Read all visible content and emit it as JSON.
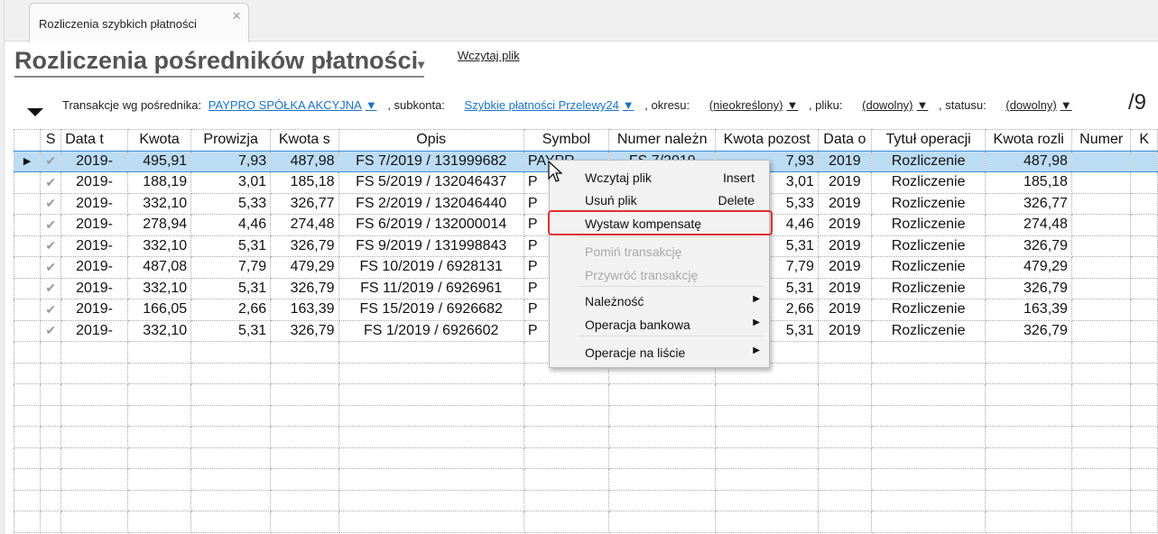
{
  "tab": {
    "label": "Rozliczenia szybkich płatności",
    "close": "×"
  },
  "header": {
    "title": "Rozliczenia pośredników płatności",
    "title_arrow": "▾",
    "load_link": "Wczytaj plik",
    "counter": "/9"
  },
  "filters": {
    "intermediary_label": "Transakcje wg pośrednika:",
    "intermediary": "PAYPRO SPÓŁKA AKCYJNA",
    "subaccount_label": ", subkonta:",
    "subaccount": "Szybkie płatności Przelewy24",
    "period_label": ", okresu:",
    "period": "(nieokreślony)",
    "file_label": ", pliku:",
    "file": "(dowolny)",
    "status_label": ", statusu:",
    "status": "(dowolny)",
    "arrow": "▼"
  },
  "columns": [
    "",
    "S",
    "Data t",
    "Kwota",
    "Prowizja",
    "Kwota s",
    "Opis",
    "Symbol",
    "Numer należn",
    "Kwota pozost",
    "Data o",
    "Tytuł operacji",
    "Kwota rozli",
    "Numer",
    "K"
  ],
  "rows": [
    [
      "2019-",
      "495,91",
      "7,93",
      "487,98",
      "FS 7/2019 / 131999682",
      "PAYPR",
      "FS 7/2019",
      "7,93",
      "2019",
      "Rozliczenie",
      "487,98"
    ],
    [
      "2019-",
      "188,19",
      "3,01",
      "185,18",
      "FS 5/2019 / 132046437",
      "P",
      "",
      "3,01",
      "2019",
      "Rozliczenie",
      "185,18"
    ],
    [
      "2019-",
      "332,10",
      "5,33",
      "326,77",
      "FS 2/2019 / 132046440",
      "P",
      "",
      "5,33",
      "2019",
      "Rozliczenie",
      "326,77"
    ],
    [
      "2019-",
      "278,94",
      "4,46",
      "274,48",
      "FS 6/2019 / 132000014",
      "P",
      "",
      "4,46",
      "2019",
      "Rozliczenie",
      "274,48"
    ],
    [
      "2019-",
      "332,10",
      "5,31",
      "326,79",
      "FS 9/2019 / 131998843",
      "P",
      "",
      "5,31",
      "2019",
      "Rozliczenie",
      "326,79"
    ],
    [
      "2019-",
      "487,08",
      "7,79",
      "479,29",
      "FS 10/2019 / 6928131",
      "P",
      "",
      "7,79",
      "2019",
      "Rozliczenie",
      "479,29"
    ],
    [
      "2019-",
      "332,10",
      "5,31",
      "326,79",
      "FS 11/2019 / 6926961",
      "P",
      "",
      "5,31",
      "2019",
      "Rozliczenie",
      "326,79"
    ],
    [
      "2019-",
      "166,05",
      "2,66",
      "163,39",
      "FS 15/2019 / 6926682",
      "P",
      "",
      "2,66",
      "2019",
      "Rozliczenie",
      "163,39"
    ],
    [
      "2019-",
      "332,10",
      "5,31",
      "326,79",
      "FS 1/2019 / 6926602",
      "P",
      "",
      "5,31",
      "2019",
      "Rozliczenie",
      "326,79"
    ]
  ],
  "context_menu": {
    "items": [
      {
        "label": "Wczytaj plik",
        "shortcut": "Insert",
        "enabled": true
      },
      {
        "label": "Usuń plik",
        "shortcut": "Delete",
        "enabled": true
      },
      {
        "label": "Wystaw kompensatę",
        "shortcut": "",
        "enabled": true,
        "highlighted": true
      },
      {
        "label": "Pomiń transakcję",
        "shortcut": "",
        "enabled": false
      },
      {
        "label": "Przywróć transakcję",
        "shortcut": "",
        "enabled": false
      },
      {
        "label": "Należność",
        "submenu": "▶",
        "enabled": true
      },
      {
        "label": "Operacja bankowa",
        "submenu": "▶",
        "enabled": true
      },
      {
        "label": "Operacje na liście",
        "submenu": "▶",
        "enabled": true
      }
    ]
  },
  "colors": {
    "selection": "#bcdcf4",
    "link": "#1a73c8",
    "highlight_border": "#e03030"
  }
}
